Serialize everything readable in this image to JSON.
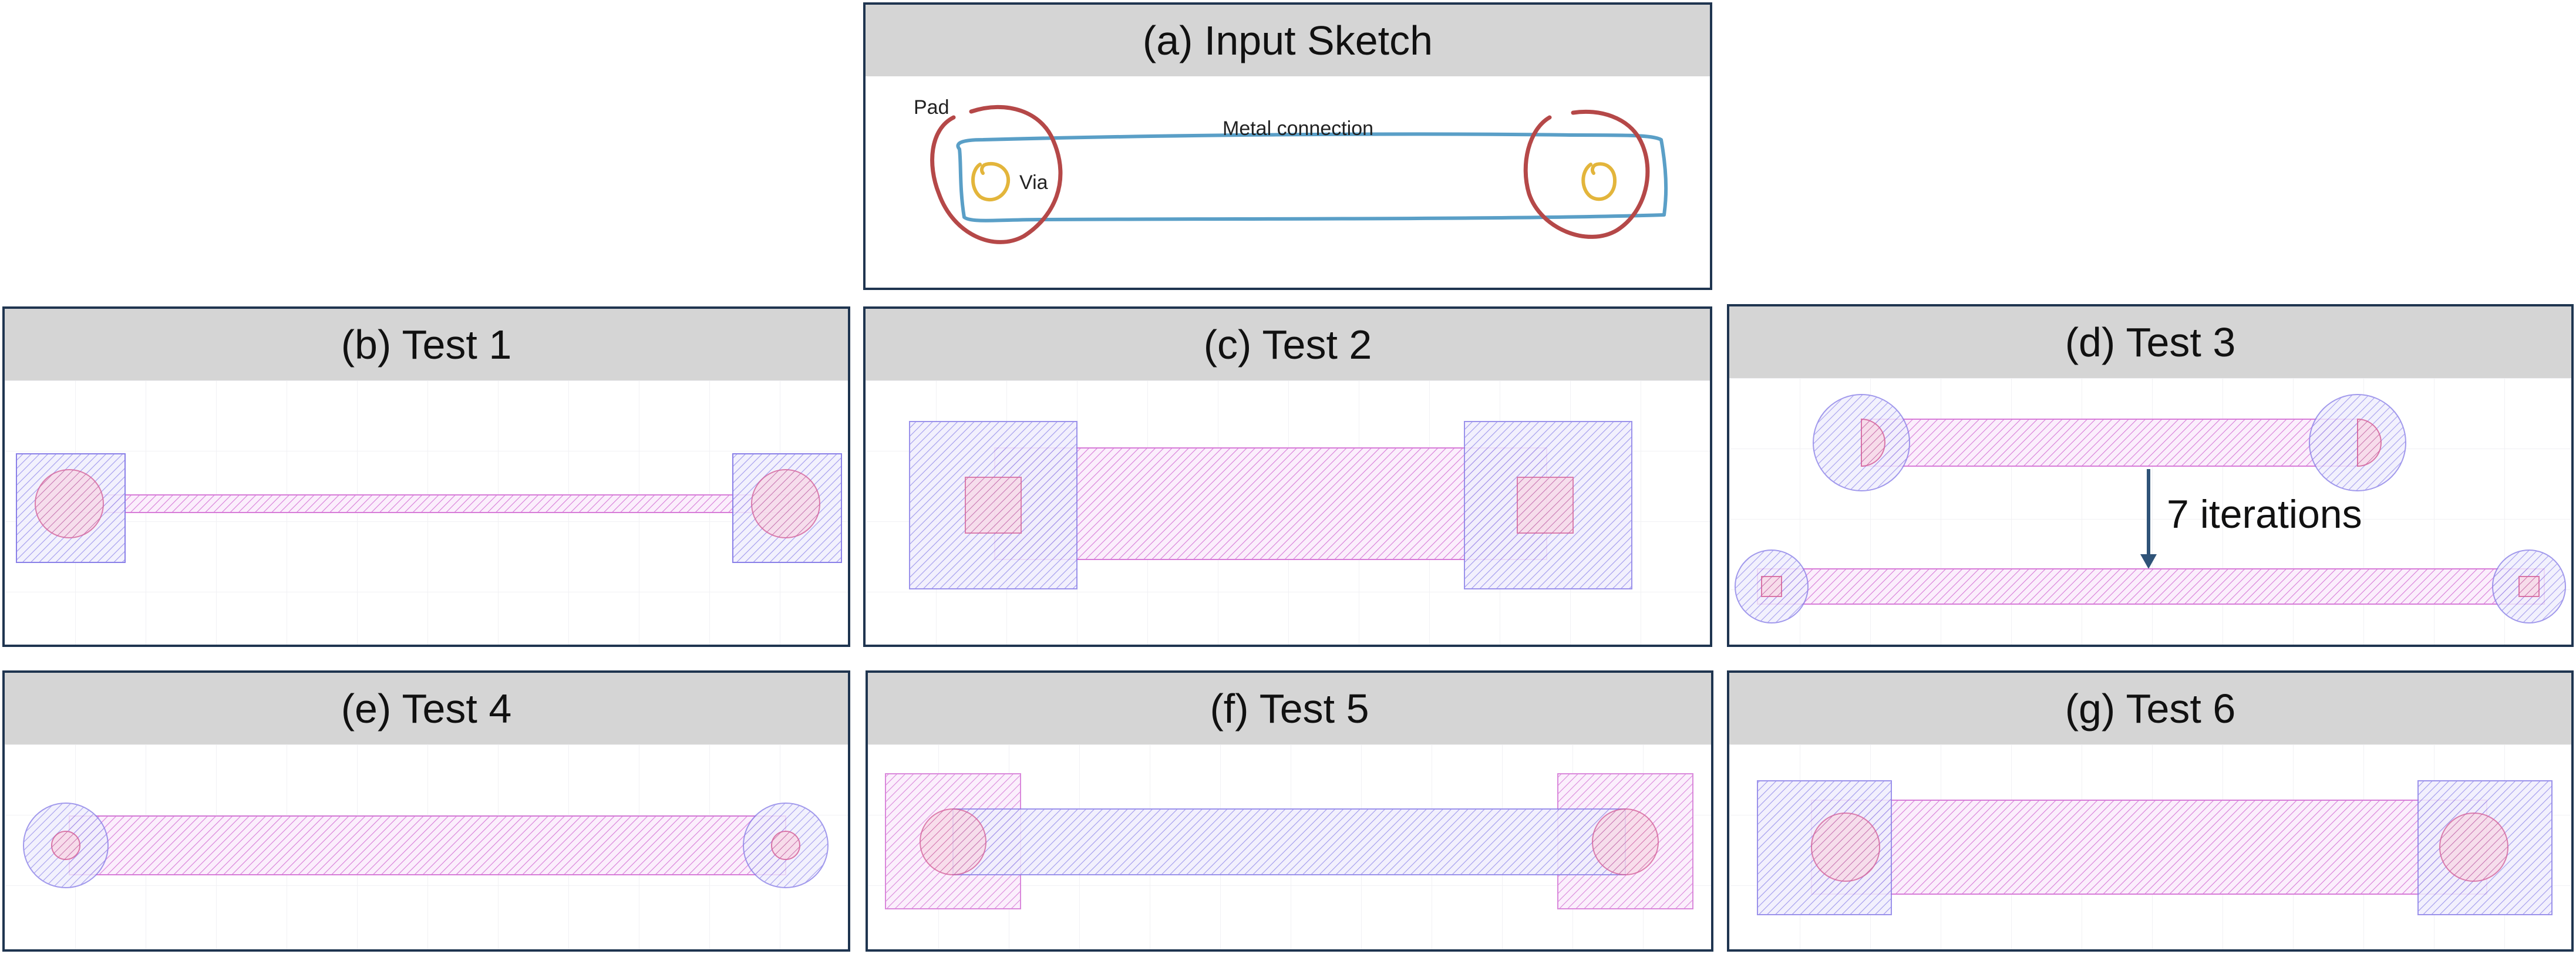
{
  "panels": {
    "a": {
      "title": "(a) Input Sketch",
      "labels": {
        "pad": "Pad",
        "via": "Via",
        "metal": "Metal connection"
      }
    },
    "b": {
      "title": "(b) Test 1"
    },
    "c": {
      "title": "(c) Test 2"
    },
    "d": {
      "title": "(d) Test 3",
      "annotation": "7 iterations"
    },
    "e": {
      "title": "(e) Test 4"
    },
    "f": {
      "title": "(f) Test 5"
    },
    "g": {
      "title": "(g) Test 6"
    }
  },
  "colors": {
    "border": "#1f3550",
    "header": "#d5d5d5",
    "pad_stroke": "#8a80e8",
    "metal_stroke": "#d77cd8",
    "via_stroke": "#d6629a",
    "sketch_pad": "#b54848",
    "sketch_metal": "#5a9fc7",
    "sketch_via": "#e3b53b",
    "arrow": "#2f5378"
  }
}
